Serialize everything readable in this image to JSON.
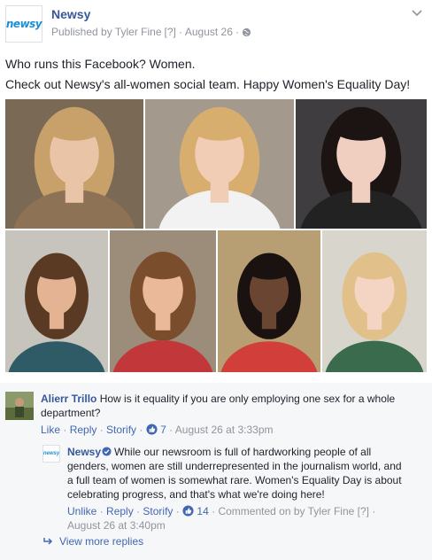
{
  "post": {
    "page_name": "Newsy",
    "logo_text": "newsy",
    "published_by": "Published by Tyler Fine",
    "help_marker": "[?]",
    "sep": "·",
    "date": "August 26",
    "line1": "Who runs this Facebook? Women.",
    "line2": "Check out Newsy's all-women social team. Happy Women's Equality Day!"
  },
  "photos": [
    {
      "bg": "#7a6a55",
      "hair": "#c7a06a",
      "skin": "#e9c4a6",
      "shirt": "#8d7256"
    },
    {
      "bg": "#a39a8d",
      "hair": "#d8ae6e",
      "skin": "#f0cdb4",
      "shirt": "#f2f2f2"
    },
    {
      "bg": "#3f3d40",
      "hair": "#1c1412",
      "skin": "#f1cfc0",
      "shirt": "#222222"
    },
    {
      "bg": "#c7c4bd",
      "hair": "#5a3a22",
      "skin": "#e4b393",
      "shirt": "#2f5b66"
    },
    {
      "bg": "#9c8d7a",
      "hair": "#7a4e2c",
      "skin": "#e9b99a",
      "shirt": "#c2383a"
    },
    {
      "bg": "#b89e73",
      "hair": "#1a1210",
      "skin": "#6a4532",
      "shirt": "#d23f3a"
    },
    {
      "bg": "#d8d5cd",
      "hair": "#e2c08a",
      "skin": "#f4d5c4",
      "shirt": "#3a6b4c"
    }
  ],
  "comments": {
    "c1_author": "Alierr Trillo",
    "c1_text": "How is it equality if you are only employing one sex for a whole department?",
    "c1_like": "Like",
    "c1_reply": "Reply",
    "c1_storify": "Storify",
    "c1_count": "7",
    "c1_time": "August 26 at 3:33pm",
    "r1_author": "Newsy",
    "r1_logo": "newsy",
    "r1_line1": "While our newsroom is full of hardworking people of all",
    "r1_line2": "genders, women are still underrepresented in the journalism world, and",
    "r1_line3": "a full team of women is somewhat rare. Women's Equality Day is about",
    "r1_line4": "celebrating progress, and that's what we're doing here!",
    "r1_unlike": "Unlike",
    "r1_reply": "Reply",
    "r1_storify": "Storify",
    "r1_count": "14",
    "r1_commented_by": "Commented on by Tyler Fine",
    "r1_help": "[?]",
    "r1_time": "August 26 at 3:40pm",
    "view_more": "View more replies"
  },
  "colors": {
    "link": "#365899",
    "action": "#4267b2",
    "meta": "#90949c",
    "comments_bg": "#f6f7f9",
    "like_badge": "#4267b2"
  }
}
